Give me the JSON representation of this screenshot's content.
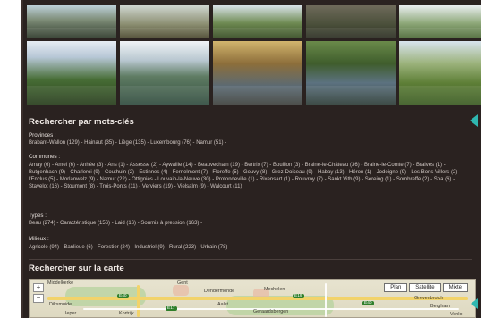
{
  "sections": {
    "keywords_title": "Rechercher par mots-clés",
    "map_title": "Rechercher sur la carte"
  },
  "groups": [
    {
      "label": "Provinces :",
      "text": "Brabant-Wallon (129) - Hainaut (35) - Liège (135) - Luxembourg (76) - Namur (51) -"
    },
    {
      "label": "Communes :",
      "text": "Amay (6) - Amel (6) - Anhée (3) - Ans (1) - Assesse (2) - Aywaille (14) - Beauvechain (19) - Bertrix (7) - Bouillon (3) - Braine-le-Château (36) - Braine-le-Comte (7) - Braives (1) - Butgenbach (9) - Charleroi (9) - Couthuin (2) - Estinnes (4) - Fernelmont (7) - Floreffe (5) - Gouvy (8) - Grez-Doiceau (9) - Habay (13) - Héron (1) - Jodoigne (9) - Les Bons Villers (2) - l'Enclus (5) - Morlanwelz (9) - Namur (22) - Ottignies - Louvain-la-Neuve (30) - Profondeville (1) - Rixensart (1) - Rouvroy (7) - Sankt Vith (9) - Sereing (1) - Sombreffe (2) - Spa (6) - Stavelot (16) - Stoumont (8) - Trois-Ponts (11) - Verviers (19) - Vielsalm (9) - Walcourt (11)"
    },
    {
      "label": "Types :",
      "text": "Beau (274) - Caractéristique (156) - Laid (16) - Soumis à pression (163) -"
    },
    {
      "label": "Milieux :",
      "text": "Agricole (94) - Banlieue (6) - Forestier (24) - Industriel (9) - Rural (223) - Urbain (78) -"
    }
  ],
  "gallery": [
    "photo-1",
    "photo-2",
    "photo-3",
    "photo-4",
    "photo-5",
    "photo-6",
    "photo-7",
    "photo-8",
    "photo-9",
    "photo-10"
  ],
  "map": {
    "labels": [
      "Middelkerke",
      "Gent",
      "Dendermonde",
      "Mechelen",
      "Aalst",
      "Geraardsbergen",
      "Diksmuide",
      "Ieper",
      "Kortrijk",
      "Bergham",
      "Grevenbroich",
      "Venlo"
    ],
    "shields": [
      "E40",
      "E17",
      "E19",
      "E40",
      "A4"
    ],
    "zoom_in": "+",
    "zoom_out": "−",
    "types": [
      "Plan",
      "Satellite",
      "Mixte"
    ]
  },
  "colors": {
    "background": "#2a2220",
    "accent": "#2fb7b0",
    "title_text": "#f2ece8",
    "body_text": "#cfc6c2"
  }
}
